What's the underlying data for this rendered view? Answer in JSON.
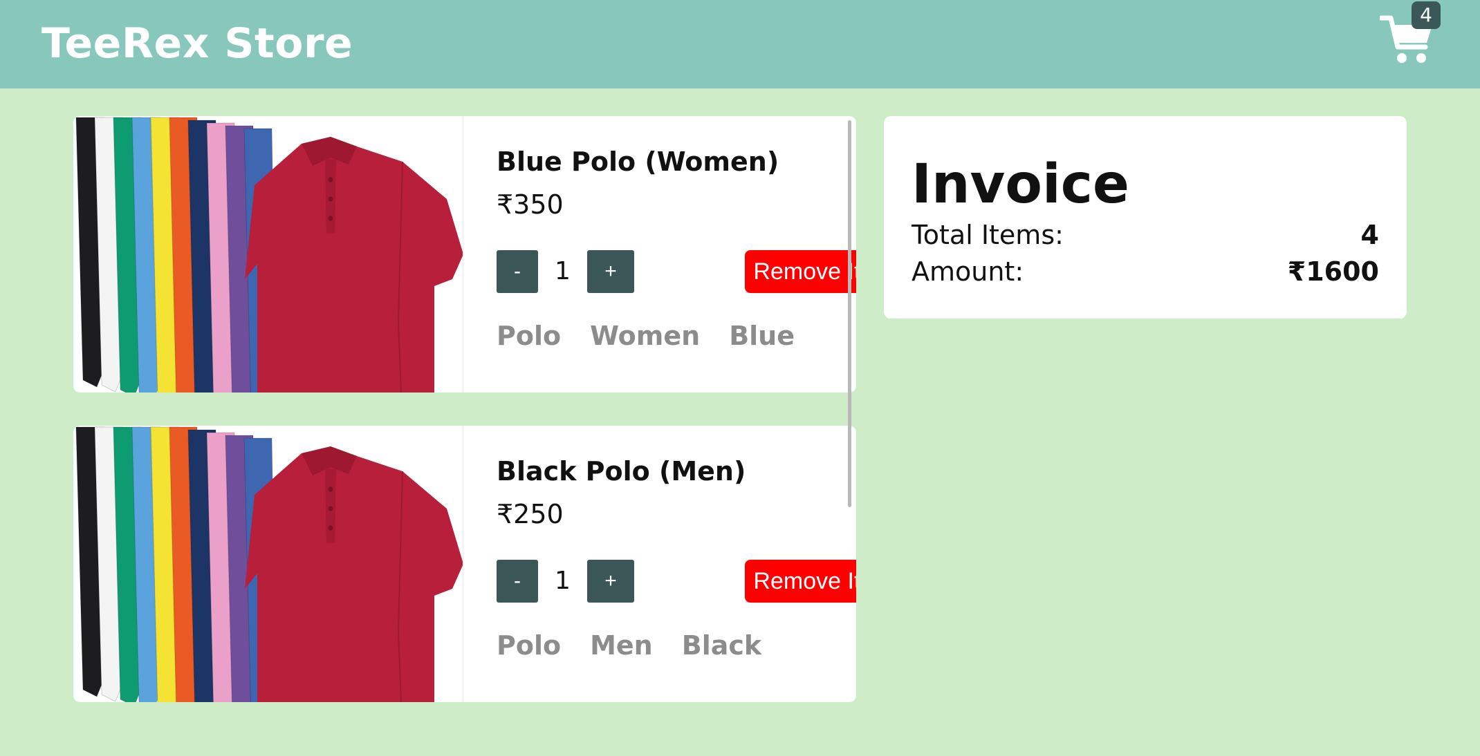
{
  "header": {
    "brand": "TeeRex Store",
    "cart_icon": "shopping-cart-icon",
    "cart_count": "4"
  },
  "cart": {
    "items": [
      {
        "name": "Blue Polo (Women)",
        "price": "₹350",
        "quantity": "1",
        "decrement_label": "-",
        "increment_label": "+",
        "remove_label": "Remove Item",
        "tags": [
          "Polo",
          "Women",
          "Blue"
        ]
      },
      {
        "name": "Black Polo (Men)",
        "price": "₹250",
        "quantity": "1",
        "decrement_label": "-",
        "increment_label": "+",
        "remove_label": "Remove Item",
        "tags": [
          "Polo",
          "Men",
          "Black"
        ]
      }
    ]
  },
  "invoice": {
    "title": "Invoice",
    "total_items_label": "Total Items:",
    "total_items_value": "4",
    "amount_label": "Amount:",
    "amount_value": "₹1600"
  },
  "colors": {
    "header_bg": "#88c7bb",
    "page_bg": "#cfecc9",
    "button_dark": "#3b5757",
    "remove_red": "#ff0000",
    "tag_gray": "#8c8c8c",
    "polo_colors": [
      "#1d1d1f",
      "#f4f4f4",
      "#0f9b72",
      "#5ba3dc",
      "#f4e332",
      "#ea5a24",
      "#1c3466",
      "#eaa0c8",
      "#6f4f9c",
      "#3f66b1",
      "#b81f3a"
    ]
  }
}
